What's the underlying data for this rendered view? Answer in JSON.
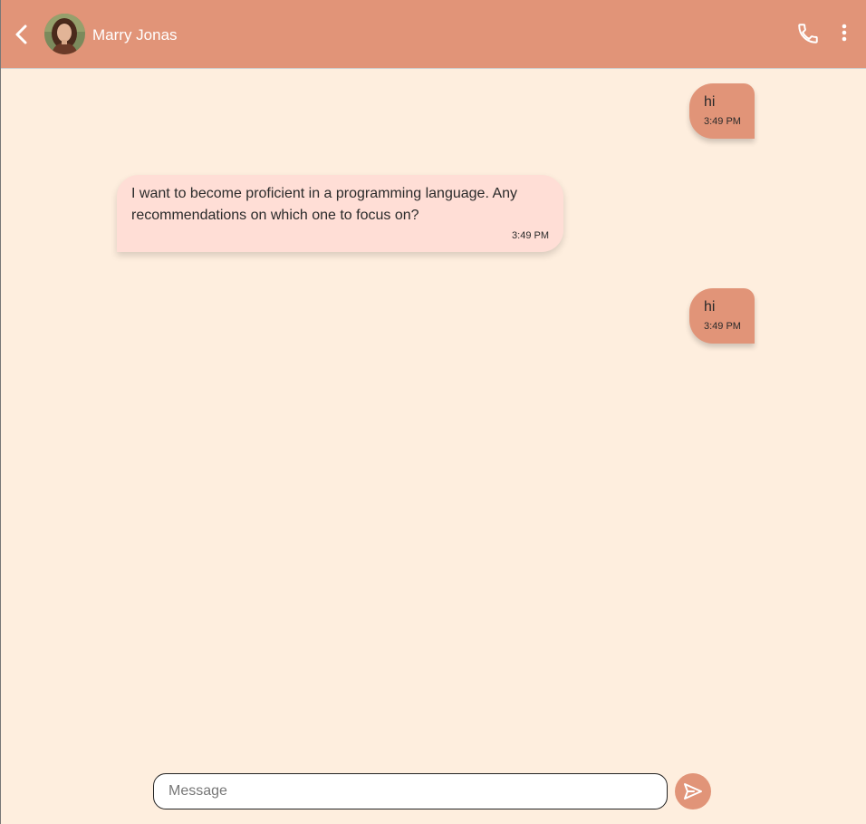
{
  "header": {
    "contact_name": "Marry Jonas",
    "avatar_icon": "person-avatar",
    "back_icon": "chevron-left-icon",
    "call_icon": "phone-icon",
    "more_icon": "more-vert-icon"
  },
  "messages": [
    {
      "direction": "outgoing",
      "text": "hi",
      "time": "3:49 PM"
    },
    {
      "direction": "incoming",
      "text": "I want to become proficient in a programming language. Any recommendations on which one to focus on?",
      "time": "3:49 PM"
    },
    {
      "direction": "outgoing",
      "text": "hi",
      "time": "3:49 PM"
    }
  ],
  "composer": {
    "placeholder": "Message",
    "value": "",
    "send_icon": "send-icon"
  },
  "colors": {
    "accent": "#e19478",
    "background": "#feeede",
    "incoming_bubble": "#ffded6"
  }
}
